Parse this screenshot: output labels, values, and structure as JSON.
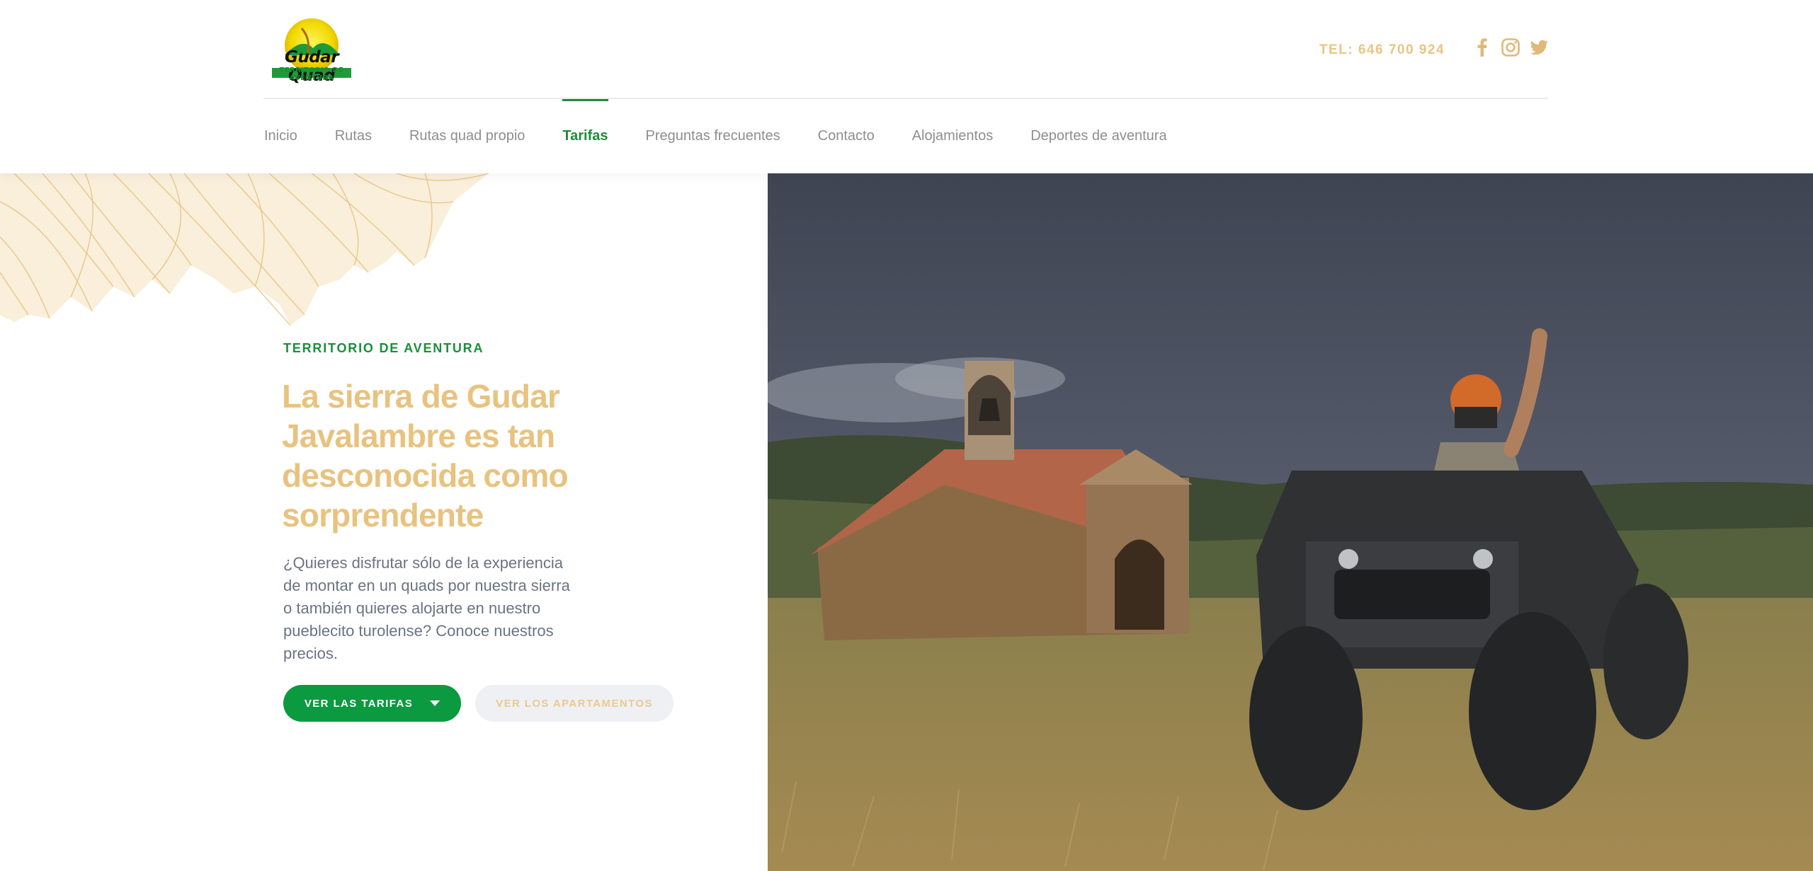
{
  "header": {
    "logo": {
      "title": "Gudar Quad",
      "subtitle": "TERRITORIO DE AVENTURA"
    },
    "phone": "TEL: 646 700 924",
    "social": [
      "facebook-icon",
      "instagram-icon",
      "twitter-icon"
    ]
  },
  "nav": {
    "items": [
      {
        "label": "Inicio",
        "active": false
      },
      {
        "label": "Rutas",
        "active": false
      },
      {
        "label": "Rutas quad propio",
        "active": false
      },
      {
        "label": "Tarifas",
        "active": true
      },
      {
        "label": "Preguntas frecuentes",
        "active": false
      },
      {
        "label": "Contacto",
        "active": false
      },
      {
        "label": "Alojamientos",
        "active": false
      },
      {
        "label": "Deportes de aventura",
        "active": false
      }
    ]
  },
  "hero": {
    "eyebrow": "TERRITORIO DE AVENTURA",
    "title": "La sierra de Gudar Javalambre es tan desconocida como sorprendente",
    "text": "¿Quieres disfrutar sólo de la experiencia de montar en un quads por nuestra sierra o también quieres alojarte en nuestro pueblecito turolense? Conoce nuestros precios.",
    "primary_button": "VER LAS TARIFAS",
    "secondary_button": "VER LOS APARTAMENTOS"
  },
  "colors": {
    "accent_green": "#0b9a3f",
    "accent_gold": "#e8c37f",
    "nav_text": "#8e8e8e",
    "body_text": "#6a7383"
  }
}
